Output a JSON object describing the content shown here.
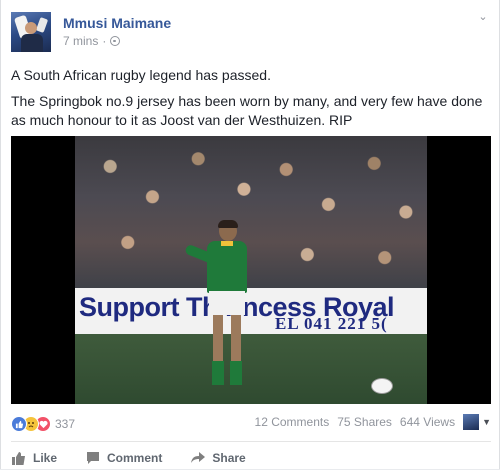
{
  "post": {
    "author": "Mmusi Maimane",
    "time": "7 mins",
    "privacy_icon": "globe-icon",
    "paragraph1": "A South African rugby legend has passed.",
    "paragraph2": "The Springbok no.9 jersey has been worn by many, and very few have done as much honour to it as Joost van der Westhuizen. RIP"
  },
  "video": {
    "banner_text": "Support Th   rincess Royal",
    "banner_subtext": "EL  041  221  5("
  },
  "stats": {
    "reaction_icons": [
      "like-icon",
      "sad-icon",
      "love-icon"
    ],
    "reactions_count": "337",
    "comments": "12 Comments",
    "shares": "75 Shares",
    "views": "644 Views"
  },
  "actions": {
    "like": "Like",
    "comment": "Comment",
    "share": "Share"
  },
  "colors": {
    "author_link": "#365899",
    "meta_gray": "#90949c",
    "like_blue": "#4a7bd9",
    "love_red": "#f25268",
    "sad_yellow": "#f5c33b"
  }
}
